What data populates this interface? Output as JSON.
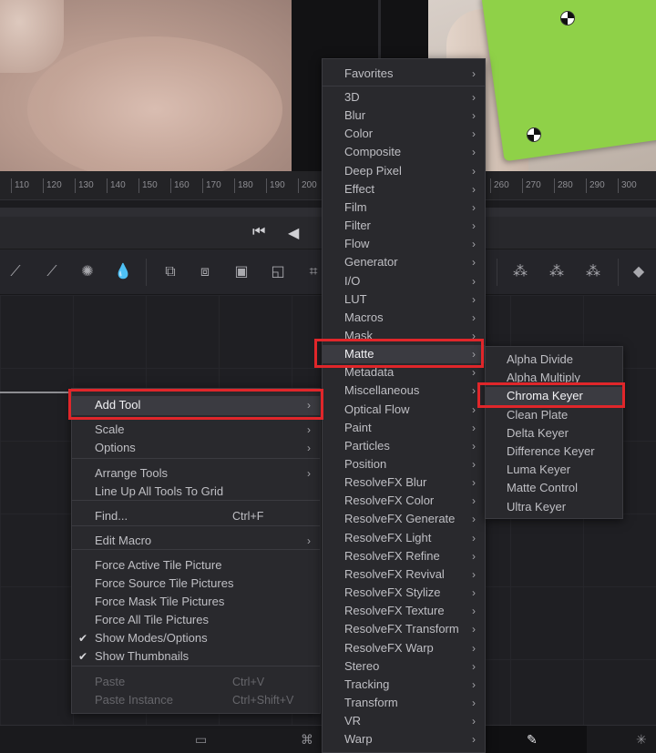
{
  "ruler": {
    "ticks": [
      "110",
      "120",
      "130",
      "140",
      "150",
      "160",
      "170",
      "180",
      "190",
      "200",
      "260",
      "270",
      "280",
      "290",
      "300"
    ]
  },
  "transport": {
    "icons": [
      "skip-to-start-icon",
      "step-back-icon"
    ]
  },
  "context_menu": {
    "items": [
      {
        "label": "Add Tool",
        "submenu": true,
        "highlighted": true
      },
      {
        "label": "Scale",
        "submenu": true
      },
      {
        "label": "Options",
        "submenu": true
      },
      {
        "label": "Arrange Tools",
        "submenu": true
      },
      {
        "label": "Line Up All Tools To Grid"
      },
      {
        "label": "Find...",
        "shortcut": "Ctrl+F"
      },
      {
        "label": "Edit Macro",
        "submenu": true
      },
      {
        "label": "Force Active Tile Picture"
      },
      {
        "label": "Force Source Tile Pictures"
      },
      {
        "label": "Force Mask Tile Pictures"
      },
      {
        "label": "Force All Tile Pictures"
      },
      {
        "label": "Show Modes/Options",
        "checked": true
      },
      {
        "label": "Show Thumbnails",
        "checked": true
      },
      {
        "label": "Paste",
        "shortcut": "Ctrl+V",
        "disabled": true
      },
      {
        "label": "Paste Instance",
        "shortcut": "Ctrl+Shift+V",
        "disabled": true
      }
    ]
  },
  "categories_menu": {
    "items": [
      "Favorites",
      "3D",
      "Blur",
      "Color",
      "Composite",
      "Deep Pixel",
      "Effect",
      "Film",
      "Filter",
      "Flow",
      "Generator",
      "I/O",
      "LUT",
      "Macros",
      "Mask",
      "Matte",
      "Metadata",
      "Miscellaneous",
      "Optical Flow",
      "Paint",
      "Particles",
      "Position",
      "ResolveFX Blur",
      "ResolveFX Color",
      "ResolveFX Generate",
      "ResolveFX Light",
      "ResolveFX Refine",
      "ResolveFX Revival",
      "ResolveFX Stylize",
      "ResolveFX Texture",
      "ResolveFX Transform",
      "ResolveFX Warp",
      "Stereo",
      "Tracking",
      "Transform",
      "VR",
      "Warp"
    ],
    "highlighted": "Matte"
  },
  "matte_menu": {
    "items": [
      "Alpha Divide",
      "Alpha Multiply",
      "Chroma Keyer",
      "Clean Plate",
      "Delta Keyer",
      "Difference Keyer",
      "Luma Keyer",
      "Matte Control",
      "Ultra Keyer"
    ],
    "highlighted": "Chroma Keyer"
  },
  "colors": {
    "menu_bg": "#29292d",
    "highlight": "#3b3b41",
    "annotation_red": "#e0262a",
    "green_screen": "#8fd148"
  }
}
